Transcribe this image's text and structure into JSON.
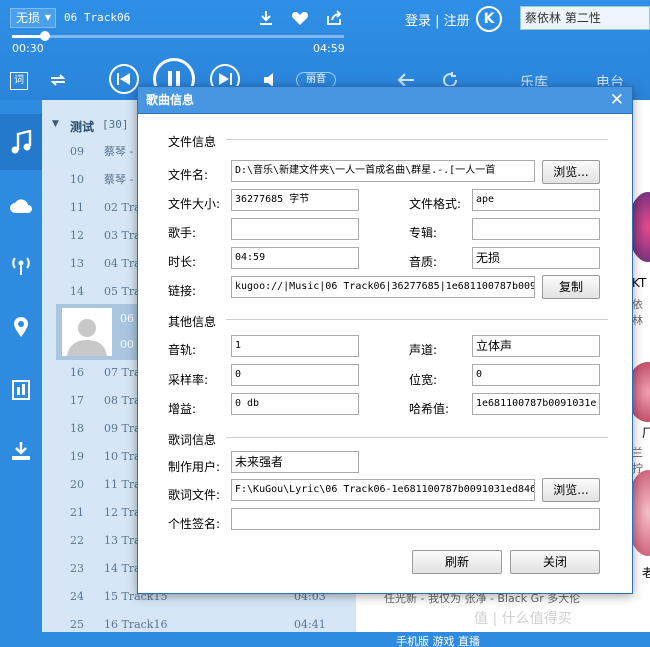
{
  "player": {
    "quality": "无损",
    "track_title": "06 Track06",
    "time_current": "00:30",
    "time_total": "04:59",
    "progress_fraction": 0.1,
    "login_text": "登录 | 注册",
    "k_logo": "K",
    "search_text": "蔡依林  第二性",
    "lyric_tag": "词",
    "sound_label": "丽音",
    "nav_library": "乐库",
    "nav_radio": "电台"
  },
  "playlist": {
    "name": "测试",
    "count": "[30]",
    "rows_top": [
      {
        "num": "09",
        "title": "蔡琴 - 恋",
        "dur": ""
      },
      {
        "num": "10",
        "title": "蔡琴 - 抵",
        "dur": ""
      },
      {
        "num": "11",
        "title": "02 Track",
        "dur": ""
      },
      {
        "num": "12",
        "title": "03 Track",
        "dur": ""
      },
      {
        "num": "13",
        "title": "04 Track",
        "dur": ""
      },
      {
        "num": "14",
        "title": "05 Track",
        "dur": ""
      }
    ],
    "selected": {
      "num": "06",
      "dur": "00"
    },
    "rows_bottom": [
      {
        "num": "16",
        "title": "07 Track",
        "dur": ""
      },
      {
        "num": "17",
        "title": "08 Track",
        "dur": ""
      },
      {
        "num": "18",
        "title": "09 Track",
        "dur": ""
      },
      {
        "num": "19",
        "title": "10 Track",
        "dur": ""
      },
      {
        "num": "20",
        "title": "11 Track",
        "dur": ""
      },
      {
        "num": "21",
        "title": "12 Track",
        "dur": ""
      },
      {
        "num": "22",
        "title": "13 Track",
        "dur": ""
      },
      {
        "num": "23",
        "title": "14 Track",
        "dur": ""
      },
      {
        "num": "24",
        "title": "15 Track15",
        "dur": "04:03"
      },
      {
        "num": "25",
        "title": "16 Track16",
        "dur": "04:41"
      }
    ]
  },
  "right_panel": {
    "side_texts": [
      "KT",
      "依林",
      "厂",
      "兰拧",
      "老"
    ],
    "bottom_line": "任光新 - 我仅为    张净 - Black Gr    多大伦",
    "bottom_bar": "手机版    游戏    直播",
    "watermark": "值 | 什么值得买"
  },
  "dialog": {
    "title": "歌曲信息",
    "close": "✕",
    "sections": {
      "file": "文件信息",
      "other": "其他信息",
      "lyric": "歌词信息"
    },
    "file": {
      "filename_label": "文件名:",
      "filename": "D:\\音乐\\新建文件夹\\一人一首成名曲\\群星.-.[一人一首",
      "browse1": "浏览...",
      "size_label": "文件大小:",
      "size": "36277685 字节",
      "format_label": "文件格式:",
      "format": "ape",
      "singer_label": "歌手:",
      "singer": "",
      "album_label": "专辑:",
      "album": "",
      "duration_label": "时长:",
      "duration": "04:59",
      "quality_label": "音质:",
      "quality": "无损",
      "link_label": "链接:",
      "link": "kugoo://|Music|06 Track06|36277685|1e681100787b009",
      "copy": "复制"
    },
    "other": {
      "track_label": "音轨:",
      "track": "1",
      "channel_label": "声道:",
      "channel": "立体声",
      "rate_label": "采样率:",
      "rate": "0",
      "bits_label": "位宽:",
      "bits": "0",
      "gain_label": "增益:",
      "gain": "0 db",
      "hash_label": "哈希值:",
      "hash": "1e681100787b0091031e"
    },
    "lyric": {
      "maker_label": "制作用户:",
      "maker": "未来强者",
      "file_label": "歌词文件:",
      "file": "F:\\KuGou\\Lyric\\06 Track06-1e681100787b0091031ed846",
      "browse2": "浏览...",
      "sign_label": "个性签名:",
      "sign": ""
    },
    "refresh": "刷新",
    "close_btn": "关闭"
  }
}
